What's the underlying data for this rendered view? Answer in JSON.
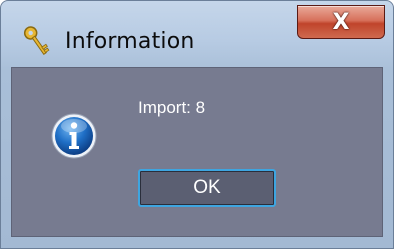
{
  "window": {
    "title": "Information",
    "title_icon": "keys-icon",
    "close_label": "X"
  },
  "dialog": {
    "icon": "info-icon",
    "message": "Import: 8",
    "ok_label": "OK"
  },
  "colors": {
    "frame": "#b7cbe3",
    "content_bg": "#777b90",
    "close_button": "#c0442b",
    "ok_focus_border": "#3ea5e0",
    "text_light": "#ffffff"
  }
}
